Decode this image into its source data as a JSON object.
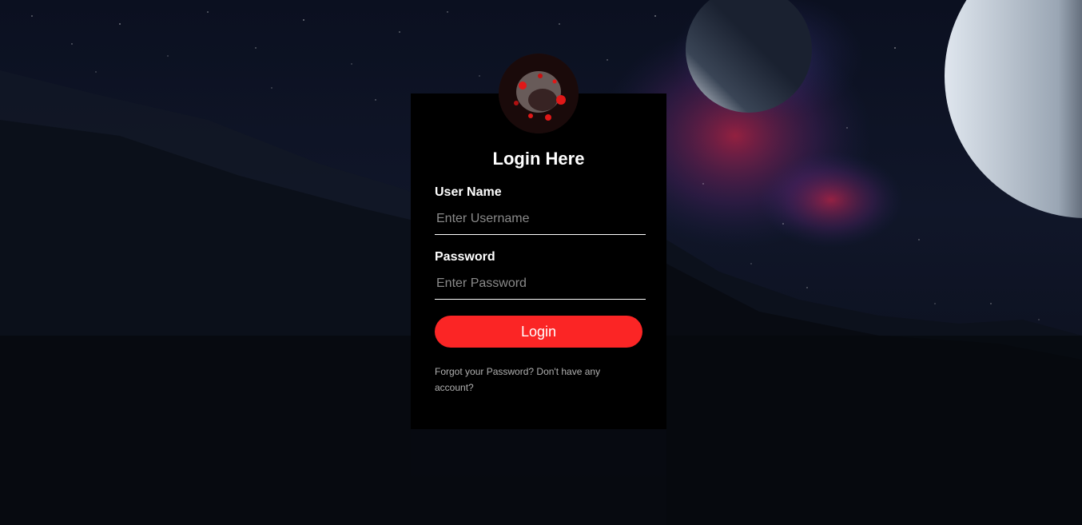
{
  "form": {
    "title": "Login Here",
    "username_label": "User Name",
    "username_placeholder": "Enter Username",
    "username_value": "",
    "password_label": "Password",
    "password_placeholder": "Enter Password",
    "password_value": "",
    "login_button": "Login",
    "forgot_link": "Forgot your Password?",
    "signup_link": "Don't have any account?"
  },
  "colors": {
    "accent": "#fb2525",
    "panel": "#000000",
    "text": "#ffffff",
    "link": "#b0b0b0"
  }
}
